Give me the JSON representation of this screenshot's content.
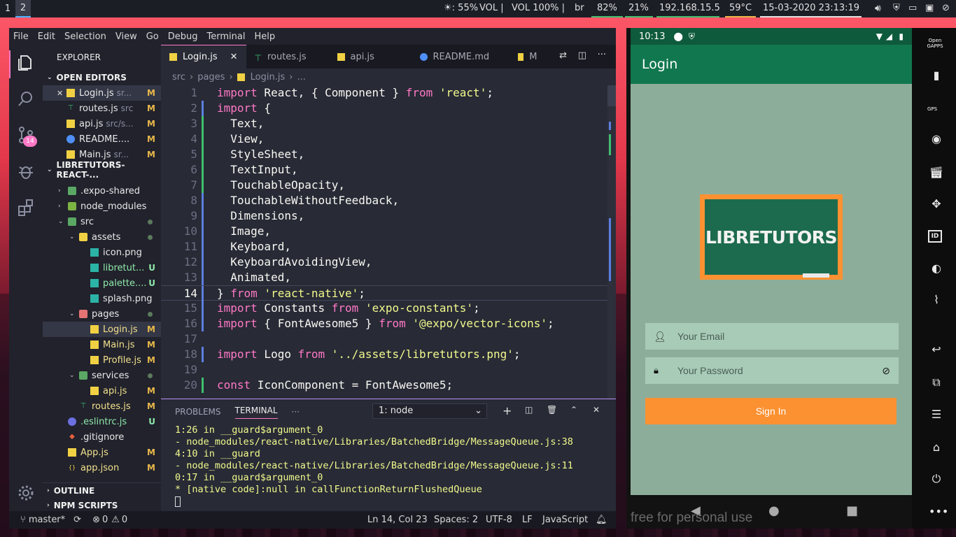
{
  "topbar": {
    "workspaces": [
      "1",
      "2"
    ],
    "brightness": "☀: 55%",
    "vol_label": "VOL |",
    "vol": "VOL 100% |",
    "lang": "br",
    "battery": "82%",
    "cpu": "21%",
    "ip": "192.168.15.5",
    "temp": "59°C",
    "datetime": "15-03-2020 23:13:19"
  },
  "vscode": {
    "menu": [
      "File",
      "Edit",
      "Selection",
      "View",
      "Go",
      "Debug",
      "Terminal",
      "Help"
    ],
    "explorer_title": "EXPLORER",
    "open_editors_title": "OPEN EDITORS",
    "open_editors": [
      {
        "name": "Login.js",
        "path": "sr...",
        "status": "M"
      },
      {
        "name": "routes.js",
        "path": "src",
        "status": "M"
      },
      {
        "name": "api.js",
        "path": "src/s...",
        "status": "M"
      },
      {
        "name": "README....",
        "path": "",
        "status": "M"
      },
      {
        "name": "Main.js",
        "path": "sr...",
        "status": "M"
      }
    ],
    "project_title": "LIBRETUTORS-REACT-...",
    "tree": [
      {
        "name": ".expo-shared",
        "indent": 1,
        "status": ""
      },
      {
        "name": "node_modules",
        "indent": 1,
        "status": ""
      },
      {
        "name": "src",
        "indent": 1,
        "status": ""
      },
      {
        "name": "assets",
        "indent": 2,
        "status": ""
      },
      {
        "name": "icon.png",
        "indent": 3,
        "status": ""
      },
      {
        "name": "libretut...",
        "indent": 3,
        "status": "U"
      },
      {
        "name": "palette....",
        "indent": 3,
        "status": "U"
      },
      {
        "name": "splash.png",
        "indent": 3,
        "status": ""
      },
      {
        "name": "pages",
        "indent": 2,
        "status": ""
      },
      {
        "name": "Login.js",
        "indent": 3,
        "status": "M"
      },
      {
        "name": "Main.js",
        "indent": 3,
        "status": "M"
      },
      {
        "name": "Profile.js",
        "indent": 3,
        "status": "M"
      },
      {
        "name": "services",
        "indent": 2,
        "status": ""
      },
      {
        "name": "api.js",
        "indent": 3,
        "status": "M"
      },
      {
        "name": "routes.js",
        "indent": 2,
        "status": "M"
      },
      {
        "name": ".eslintrc.js",
        "indent": 1,
        "status": "U"
      },
      {
        "name": ".gitignore",
        "indent": 1,
        "status": ""
      },
      {
        "name": "App.js",
        "indent": 1,
        "status": "M"
      },
      {
        "name": "app.json",
        "indent": 1,
        "status": "M"
      }
    ],
    "outline_title": "OUTLINE",
    "npm_title": "NPM SCRIPTS",
    "scm_badge": "14",
    "tabs": [
      "Login.js",
      "routes.js",
      "api.js",
      "README.md",
      "M"
    ],
    "breadcrumb": [
      "src",
      "pages",
      "Login.js",
      "..."
    ],
    "code_lines": [
      "import React, { Component } from 'react';",
      "import {",
      "  Text,",
      "  View,",
      "  StyleSheet,",
      "  TextInput,",
      "  TouchableOpacity,",
      "  TouchableWithoutFeedback,",
      "  Dimensions,",
      "  Image,",
      "  Keyboard,",
      "  KeyboardAvoidingView,",
      "  Animated,",
      "} from 'react-native';",
      "import Constants from 'expo-constants';",
      "import { FontAwesome5 } from '@expo/vector-icons';",
      "",
      "import Logo from '../assets/libretutors.png';",
      "",
      "const IconComponent = FontAwesome5;"
    ],
    "panel_tabs": [
      "PROBLEMS",
      "TERMINAL",
      "···"
    ],
    "terminal_select": "1: node",
    "terminal_lines": [
      "1:26 in __guard$argument_0",
      "- node_modules/react-native/Libraries/BatchedBridge/MessageQueue.js:38",
      "4:10 in __guard",
      "- node_modules/react-native/Libraries/BatchedBridge/MessageQueue.js:11",
      "0:17 in __guard$argument_0",
      "* [native code]:null in callFunctionReturnFlushedQueue"
    ],
    "status": {
      "branch": "master*",
      "errors": "0",
      "warnings": "0",
      "position": "Ln 14, Col 23",
      "spaces": "Spaces: 2",
      "encoding": "UTF-8",
      "eol": "LF",
      "language": "JavaScript"
    }
  },
  "phone": {
    "time": "10:13",
    "title": "Login",
    "logo_text": "LIBRETUTORS",
    "email_placeholder": "Your Email",
    "password_placeholder": "Your Password",
    "signin_label": "Sign In",
    "watermark": "free for personal use",
    "side_top": "Open GAPPS",
    "gps": "GPS",
    "id": "ID"
  },
  "colors": {
    "accent_orange": "#fc9132",
    "app_green": "#11774f",
    "screen_bg": "#8dad9b",
    "editor_bg": "#282a36"
  }
}
